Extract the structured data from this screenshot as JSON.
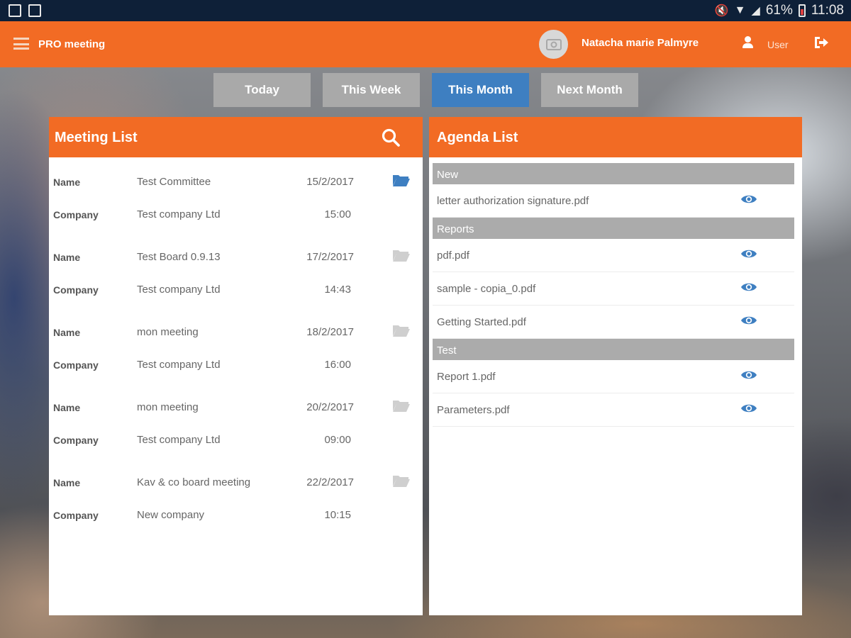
{
  "status_bar": {
    "battery": "61%",
    "time": "11:08"
  },
  "app": {
    "title": "PRO meeting"
  },
  "user": {
    "name": "Natacha marie Palmyre",
    "role_label": "User"
  },
  "period_tabs": [
    {
      "label": "Today",
      "active": false
    },
    {
      "label": "This Week",
      "active": false
    },
    {
      "label": "This Month",
      "active": true
    },
    {
      "label": "Next Month",
      "active": false
    }
  ],
  "meeting_list": {
    "title": "Meeting List",
    "field_labels": {
      "name": "Name",
      "company": "Company"
    },
    "meetings": [
      {
        "name": "Test Committee",
        "date": "15/2/2017",
        "company": "Test company Ltd",
        "time": "15:00",
        "selected": true
      },
      {
        "name": "Test Board 0.9.13",
        "date": "17/2/2017",
        "company": "Test company Ltd",
        "time": "14:43",
        "selected": false
      },
      {
        "name": "mon meeting",
        "date": "18/2/2017",
        "company": "Test company Ltd",
        "time": "16:00",
        "selected": false
      },
      {
        "name": "mon meeting",
        "date": "20/2/2017",
        "company": "Test company Ltd",
        "time": "09:00",
        "selected": false
      },
      {
        "name": "Kav & co board meeting",
        "date": "22/2/2017",
        "company": "New company",
        "time": "10:15",
        "selected": false
      }
    ]
  },
  "agenda_list": {
    "title": "Agenda List",
    "sections": [
      {
        "title": "New",
        "items": [
          "letter authorization signature.pdf"
        ]
      },
      {
        "title": "Reports",
        "items": [
          "pdf.pdf",
          "sample - copia_0.pdf",
          "Getting Started.pdf"
        ]
      },
      {
        "title": "Test",
        "items": [
          "Report 1.pdf",
          "Parameters.pdf"
        ]
      }
    ]
  },
  "colors": {
    "brand_orange": "#f26b24",
    "active_tab": "#3e7fc1",
    "inactive_tab": "#a9a9a9",
    "icon_blue": "#3e7fc1",
    "icon_grey": "#cfcfcf"
  }
}
